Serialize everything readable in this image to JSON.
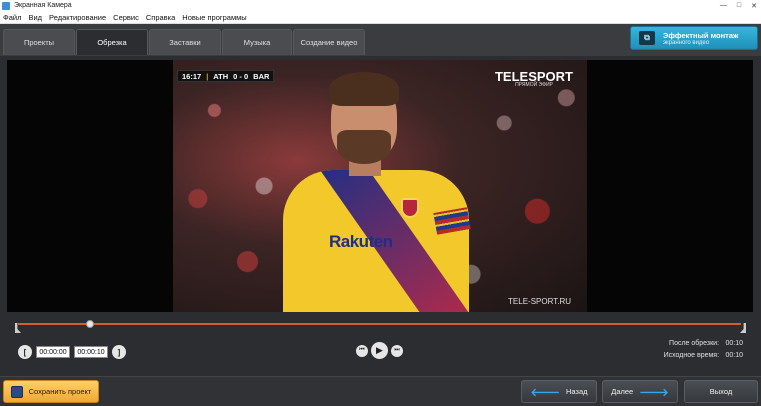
{
  "window": {
    "title": "Экранная Камера"
  },
  "menu": [
    "Файл",
    "Вид",
    "Редактирование",
    "Сервис",
    "Справка",
    "Новые программы"
  ],
  "tabs": [
    {
      "label": "Проекты",
      "active": false
    },
    {
      "label": "Обрезка",
      "active": true
    },
    {
      "label": "Заставки",
      "active": false
    },
    {
      "label": "Музыка",
      "active": false
    },
    {
      "label": "Создание видео",
      "active": false
    }
  ],
  "promo": {
    "title": "Эффектный монтаж",
    "subtitle": "экранного видео"
  },
  "video": {
    "scoreboard": {
      "time": "16:17",
      "home": "ATH",
      "score": "0 - 0",
      "away": "BAR"
    },
    "broadcaster": "TELESPORT",
    "broadcaster_sub": "ПРЯМОЙ ЭФИР",
    "watermark": "TELE-SPORT.RU",
    "shirt_sponsor": "Rakuten"
  },
  "trim": {
    "start_time": "00:00:00",
    "end_time": "00:00:10",
    "playhead_fraction": 0.1,
    "after_trim_label": "После обрезки:",
    "after_trim_value": "00:10",
    "original_label": "Исходное время:",
    "original_value": "00:10"
  },
  "footer": {
    "save_label": "Сохранить проект",
    "back_label": "Назад",
    "next_label": "Далее",
    "exit_label": "Выход"
  },
  "colors": {
    "accent_orange": "#d2602a",
    "promo_blue": "#1f8fba",
    "save_yellow": "#f0a830"
  }
}
